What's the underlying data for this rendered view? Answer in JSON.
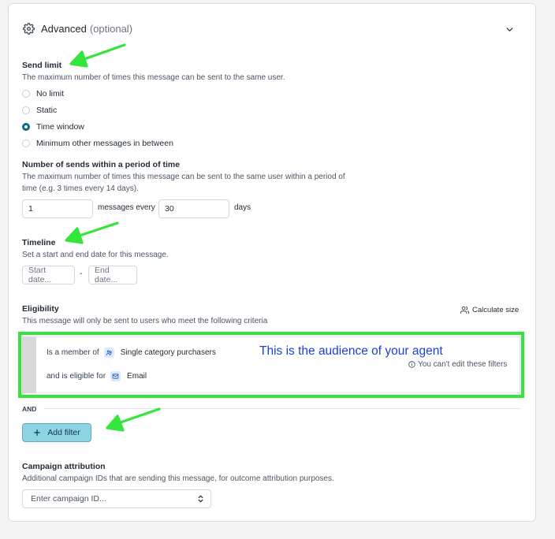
{
  "header": {
    "title": "Advanced",
    "optional": "(optional)"
  },
  "send_limit": {
    "label": "Send limit",
    "description": "The maximum number of times this message can be sent to the same user.",
    "options": [
      "No limit",
      "Static",
      "Time window",
      "Minimum other messages in between"
    ],
    "selected": "Time window"
  },
  "sends_period": {
    "label": "Number of sends within a period of time",
    "description_line1": "The maximum number of times this message can be sent to the same user within a period of",
    "description_line2": "time (e.g. 3 times every 14 days).",
    "count_value": "1",
    "middle_label": "messages every",
    "days_value": "30",
    "unit_label": "days"
  },
  "timeline": {
    "label": "Timeline",
    "description": "Set a start and end date for this message.",
    "start_placeholder": "Start date...",
    "separator": "-",
    "end_placeholder": "End date..."
  },
  "eligibility": {
    "label": "Eligibility",
    "description": "This message will only be sent to users who meet the following criteria",
    "calculate": "Calculate size",
    "row1_prefix": "Is a member of",
    "row1_value": "Single category purchasers",
    "row2_prefix": "and is eligible for",
    "row2_value": "Email",
    "annotation": "This is the audience of your agent",
    "note": "You can't edit these filters"
  },
  "filters": {
    "and_label": "AND",
    "add_filter": "Add filter"
  },
  "campaign": {
    "label": "Campaign attribution",
    "description": "Additional campaign IDs that are sending this message, for outcome attribution purposes.",
    "placeholder": "Enter campaign ID..."
  },
  "colors": {
    "accent": "#0d6b86",
    "annotation_green": "#34e53a",
    "annotation_blue": "#1c3fd6",
    "button_bg": "#8ed3e2"
  }
}
